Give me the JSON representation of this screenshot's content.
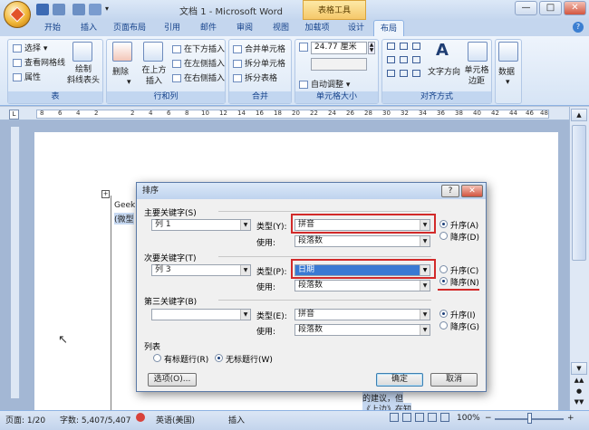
{
  "window": {
    "title": "文档 1 - Microsoft Word",
    "contextual_tab": "表格工具",
    "controls": {
      "minimize": "—",
      "maximize": "□",
      "close": "✕"
    }
  },
  "tabs": [
    "开始",
    "插入",
    "页面布局",
    "引用",
    "邮件",
    "审阅",
    "视图",
    "加载项",
    "设计",
    "布局"
  ],
  "active_tab": "布局",
  "ribbon": {
    "table_group": {
      "label": "表",
      "select": "选择",
      "gridlines": "查看网格线",
      "properties": "属性",
      "draw_diagonal": "绘制\n斜线表头"
    },
    "rows_cols_group": {
      "label": "行和列",
      "delete": "删除",
      "insert_above": "在上方\n插入",
      "insert_below": "在下方插入",
      "insert_left": "在左侧插入",
      "insert_right": "在右侧插入"
    },
    "merge_group": {
      "label": "合并",
      "merge": "合并单元格",
      "split": "拆分单元格",
      "split_table": "拆分表格"
    },
    "cell_size_group": {
      "label": "单元格大小",
      "width_value": "24.77 厘米",
      "autofit": "自动调整"
    },
    "align_group": {
      "label": "对齐方式",
      "text_direction": "文字方向",
      "cell_margins": "单元格\n边距"
    },
    "data_group": {
      "label": "数据"
    }
  },
  "ruler_numbers": [
    "8",
    "6",
    "4",
    "2",
    "2",
    "4",
    "6",
    "8",
    "10",
    "12",
    "14",
    "16",
    "18",
    "20",
    "22",
    "24",
    "26",
    "28",
    "30",
    "32",
    "34",
    "36",
    "38",
    "40",
    "42",
    "44",
    "46",
    "48"
  ],
  "document": {
    "cell_text_1": "Geek",
    "cell_text_2": "(微型",
    "bottom_text_1": "的建议，但",
    "bottom_text_2": "《上边》在知"
  },
  "dialog": {
    "title": "排序",
    "help": "?",
    "close": "✕",
    "primary_key": {
      "label": "主要关键字(S)",
      "field": "列 1",
      "type_label": "类型(Y):",
      "type_value": "拼音",
      "using_label": "使用:",
      "using_value": "段落数",
      "asc": "升序(A)",
      "desc": "降序(D)",
      "order": "asc"
    },
    "secondary_key": {
      "label": "次要关键字(T)",
      "field": "列 3",
      "type_label": "类型(P):",
      "type_value": "日期",
      "using_label": "使用:",
      "using_value": "段落数",
      "asc": "升序(C)",
      "desc": "降序(N)",
      "order": "desc"
    },
    "tertiary_key": {
      "label": "第三关键字(B)",
      "field": "",
      "type_label": "类型(E):",
      "type_value": "拼音",
      "using_label": "使用:",
      "using_value": "段落数",
      "asc": "升序(I)",
      "desc": "降序(G)",
      "order": "asc"
    },
    "list": {
      "label": "列表",
      "has_header": "有标题行(R)",
      "no_header": "无标题行(W)",
      "selected": "no_header"
    },
    "options_button": "选项(O)...",
    "ok_button": "确定",
    "cancel_button": "取消"
  },
  "status_bar": {
    "page": "页面: 1/20",
    "words": "字数: 5,407/5,407",
    "language": "英语(美国)",
    "mode": "插入",
    "zoom": "100%",
    "zoom_minus": "−",
    "zoom_plus": "+"
  },
  "colors": {
    "accent_red": "#d22a2a",
    "selection_blue": "#3a79d3",
    "ribbon_blue": "#c4d6ee"
  }
}
